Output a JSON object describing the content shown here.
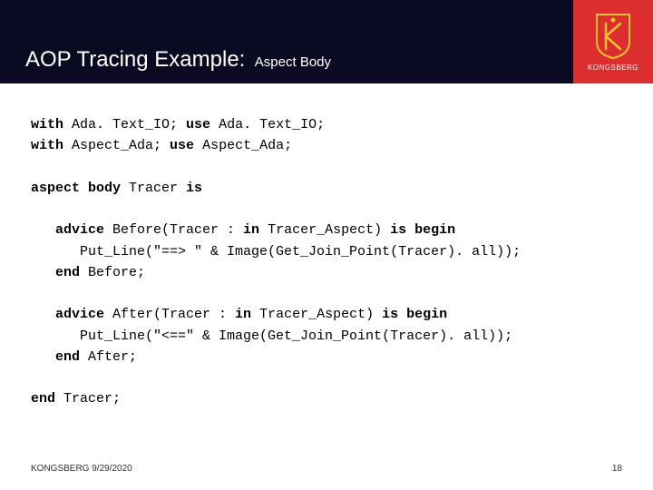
{
  "header": {
    "title": "AOP Tracing Example:",
    "subtitle": "Aspect Body",
    "brand": "KONGSBERG"
  },
  "code": {
    "l1a": "with",
    "l1b": " Ada. Text_IO; ",
    "l1c": "use",
    "l1d": " Ada. Text_IO;",
    "l2a": "with",
    "l2b": " Aspect_Ada; ",
    "l2c": "use",
    "l2d": " Aspect_Ada;",
    "l3a": "aspect body",
    "l3b": " Tracer ",
    "l3c": "is",
    "l4a": "   advice",
    "l4b": " Before(Tracer : ",
    "l4c": "in",
    "l4d": " Tracer_Aspect) ",
    "l4e": "is begin",
    "l5": "      Put_Line(\"==> \" & Image(Get_Join_Point(Tracer). all));",
    "l6a": "   end",
    "l6b": " Before;",
    "l7a": "   advice",
    "l7b": " After(Tracer : ",
    "l7c": "in",
    "l7d": " Tracer_Aspect) ",
    "l7e": "is begin",
    "l8": "      Put_Line(\"<==\" & Image(Get_Join_Point(Tracer). all));",
    "l9a": "   end",
    "l9b": " After;",
    "l10a": "end",
    "l10b": " Tracer;"
  },
  "footer": {
    "left": "KONGSBERG 9/29/2020",
    "page": "18"
  }
}
